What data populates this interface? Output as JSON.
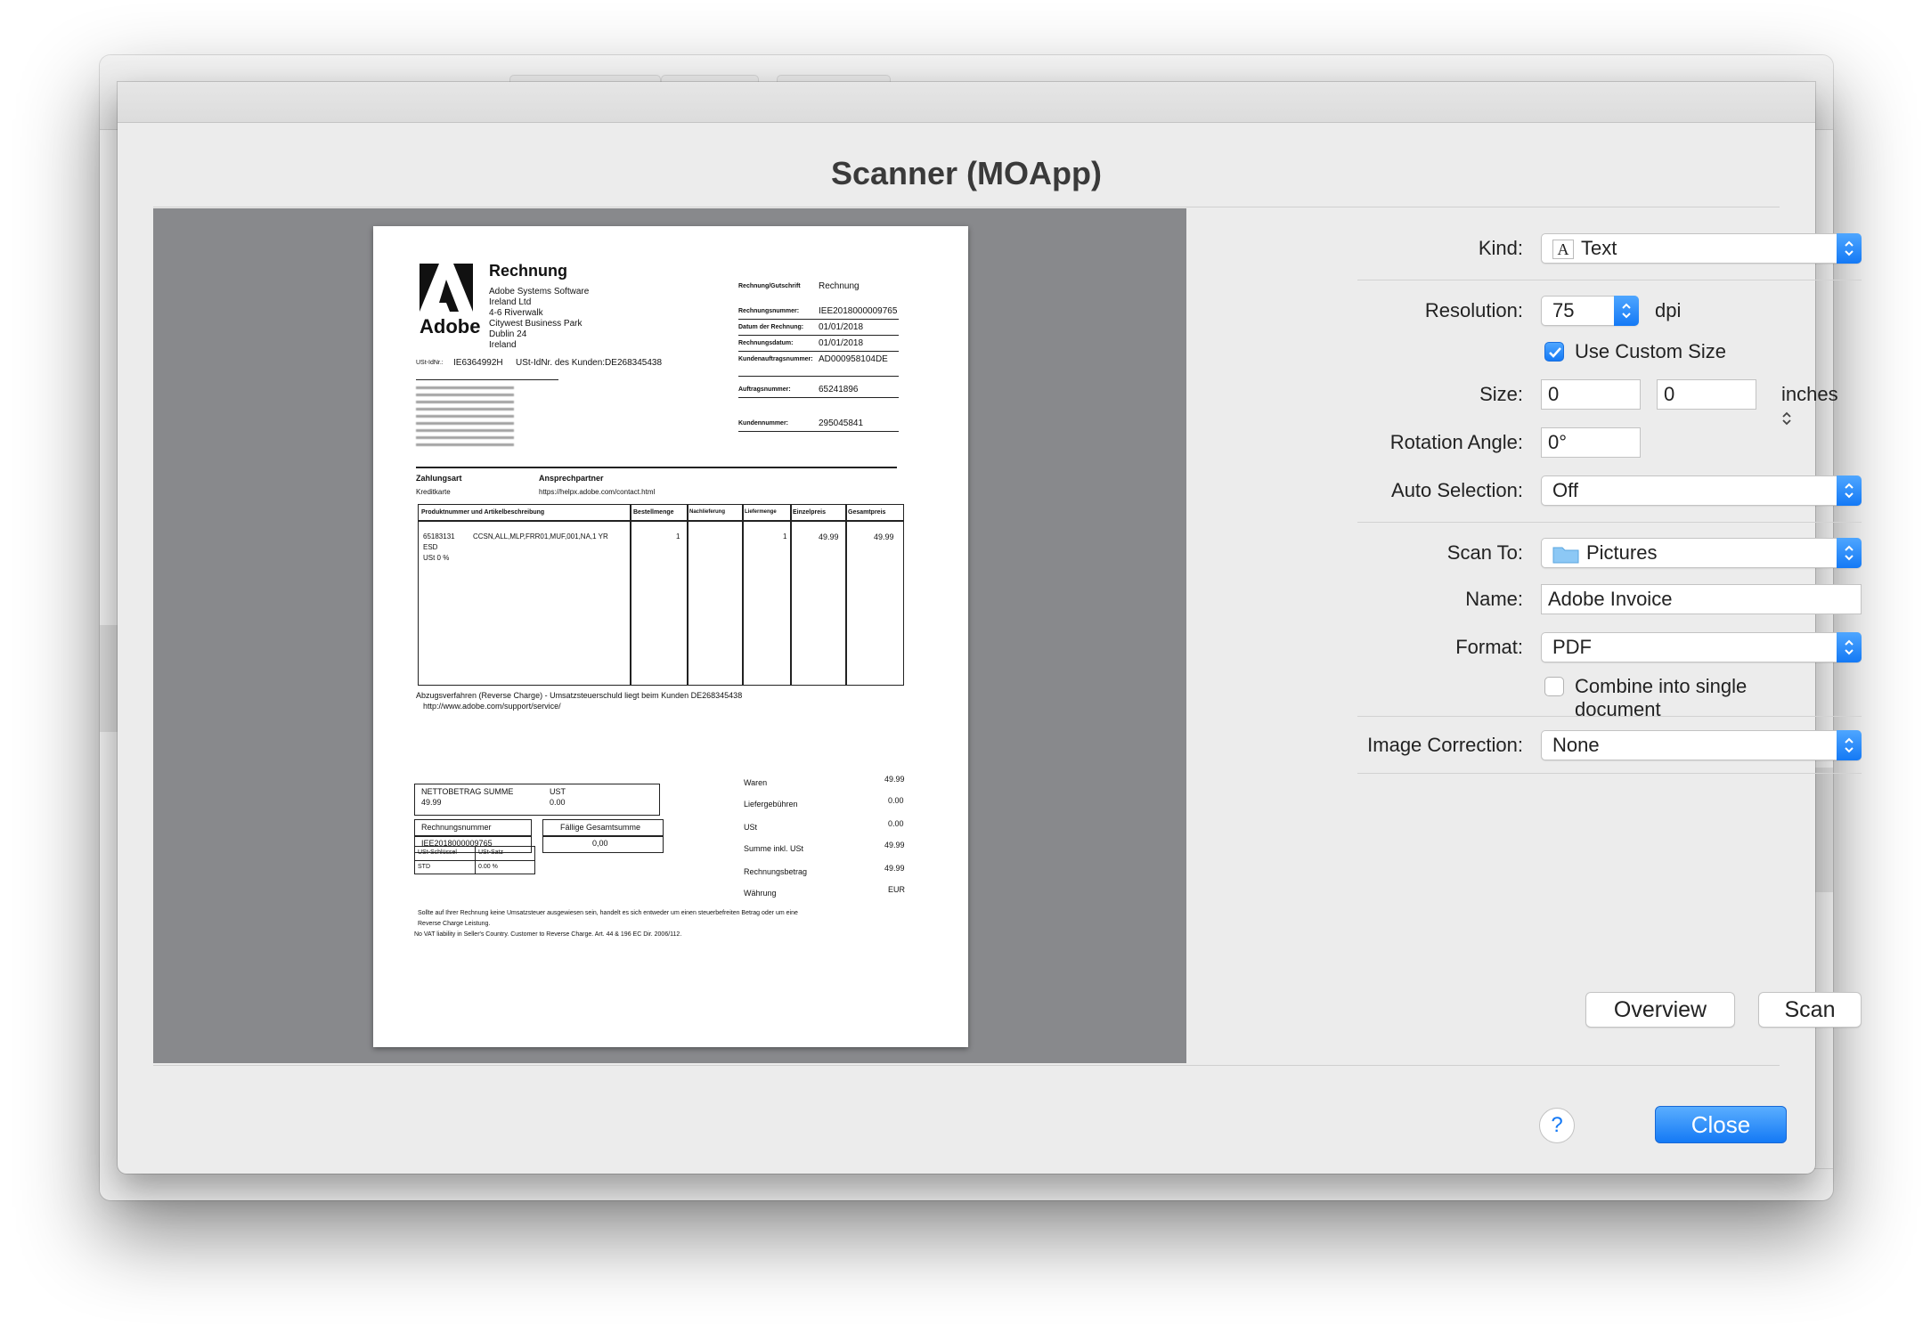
{
  "dialog": {
    "title": "Scanner (MOApp)"
  },
  "settings": {
    "kind": {
      "label": "Kind:",
      "value": "Text",
      "icon": "text-format-icon"
    },
    "resolution": {
      "label": "Resolution:",
      "value": "75",
      "unit": "dpi"
    },
    "use_custom_size": {
      "label": "Use Custom Size",
      "checked": true
    },
    "size": {
      "label": "Size:",
      "width": "0",
      "height": "0",
      "unit": "inches"
    },
    "rotation": {
      "label": "Rotation Angle:",
      "value": "0°"
    },
    "auto_selection": {
      "label": "Auto Selection:",
      "value": "Off"
    },
    "scan_to": {
      "label": "Scan To:",
      "value": "Pictures",
      "icon": "folder-icon"
    },
    "name": {
      "label": "Name:",
      "value": "Adobe Invoice"
    },
    "format": {
      "label": "Format:",
      "value": "PDF"
    },
    "combine": {
      "label": "Combine into single document",
      "checked": false
    },
    "image_correction": {
      "label": "Image Correction:",
      "value": "None"
    }
  },
  "buttons": {
    "overview": "Overview",
    "scan": "Scan",
    "help": "?",
    "close": "Close"
  },
  "colors": {
    "accent": "#1479f5",
    "preview_bg": "#88898c",
    "dialog_bg": "#ececec"
  },
  "document": {
    "logo_text": "Adobe",
    "heading": "Rechnung",
    "company": [
      "Adobe Systems Software",
      "Ireland Ltd",
      "4-6 Riverwalk",
      "Citywest Business Park",
      "Dublin 24",
      "Ireland"
    ],
    "vat_line_prefix": "USt-IdNr.:",
    "vat_id": "IE6364992H",
    "customer_vat": "USt-IdNr. des Kunden:DE268345438",
    "meta": [
      {
        "label": "Rechnung/Gutschrift",
        "value": "Rechnung"
      },
      {
        "label": "Rechnungsnummer:",
        "value": "IEE2018000009765"
      },
      {
        "label": "Datum der Rechnung:",
        "value": "01/01/2018"
      },
      {
        "label": "Rechnungsdatum:",
        "value": "01/01/2018"
      },
      {
        "label": "Kundenauftragsnummer:",
        "value": "AD000958104DE"
      },
      {
        "label": "Auftragsnummer:",
        "value": "65241896"
      },
      {
        "label": "Kundennummer:",
        "value": "295045841"
      }
    ],
    "payment": {
      "h1": "Zahlungsart",
      "h2": "Ansprechpartner",
      "v1": "Kreditkarte",
      "v2": "https://helpx.adobe.com/contact.html"
    },
    "table_headers": [
      "Produktnummer und Artikelbeschreibung",
      "Bestellmenge",
      "Nachlieferung",
      "Liefermenge",
      "Einzelpreis",
      "Gesamtpreis"
    ],
    "item": {
      "code": "65183131",
      "desc": "CCSN,ALL,MLP,FRR01,MUF,001,NA,1 YR",
      "line2": "ESD",
      "line3": "USt 0 %",
      "qty": "1",
      "delivered": "1",
      "unit": "49.99",
      "total": "49.99"
    },
    "reverse_charge": "Abzugsverfahren (Reverse Charge) - Umsatzsteuerschuld liegt beim Kunden  DE268345438",
    "support_url": "http://www.adobe.com/support/service/",
    "net_box": {
      "label": "NETTOBETRAG SUMME",
      "value": "49.99",
      "vat_label": "UST",
      "vat_value": "0.00"
    },
    "invoice_box": {
      "label": "Rechnungsnummer",
      "value": "IEE2018000009765",
      "due_label": "Fällige Gesamtsumme",
      "due_value": "0,00"
    },
    "tax_box": {
      "h1": "USt-Schlüssel",
      "h2": "USt-Satz",
      "v1": "STD",
      "v2": "0.00 %"
    },
    "summary": [
      {
        "label": "Waren",
        "value": "49.99"
      },
      {
        "label": "Liefergebühren",
        "value": "0.00"
      },
      {
        "label": "USt",
        "value": "0.00"
      },
      {
        "label": "Summe inkl. USt",
        "value": "49.99"
      },
      {
        "label": "Rechnungsbetrag",
        "value": "49.99"
      },
      {
        "label": "Währung",
        "value": "EUR"
      }
    ],
    "footnote": [
      "Sollte auf Ihrer Rechnung keine Umsatzsteuer ausgewiesen sein, handelt es sich entweder um einen steuerbefreiten Betrag oder um eine",
      "Reverse Charge Leistung.",
      "No VAT liability in Seller's Country. Customer to Reverse Charge. Art. 44 & 196 EC Dir. 2006/112."
    ]
  }
}
